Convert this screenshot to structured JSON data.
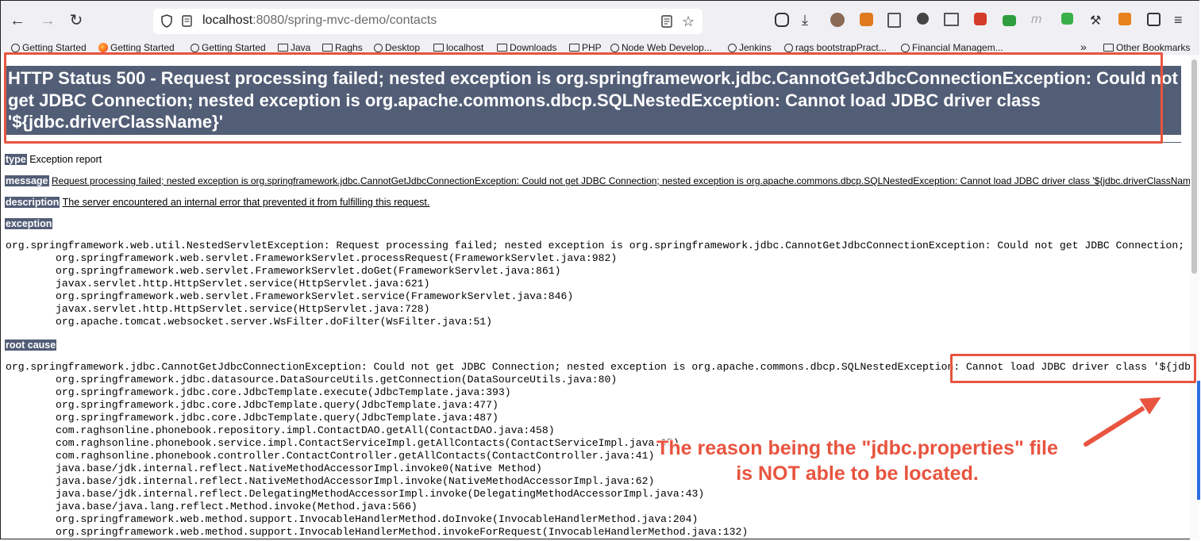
{
  "browser": {
    "url_host": "localhost",
    "url_rest": ":8080/spring-mvc-demo/contacts"
  },
  "bookmarks": [
    {
      "label": "Getting Started",
      "icon": "globe-icon"
    },
    {
      "label": "Getting Started",
      "icon": "firefox-icon"
    },
    {
      "label": "Getting Started",
      "icon": "globe-icon"
    },
    {
      "label": "Java",
      "icon": "folder-icon"
    },
    {
      "label": "Raghs",
      "icon": "folder-icon"
    },
    {
      "label": "Desktop",
      "icon": "globe-icon"
    },
    {
      "label": "localhost",
      "icon": "folder-icon"
    },
    {
      "label": "Downloads",
      "icon": "folder-icon"
    },
    {
      "label": "PHP",
      "icon": "folder-icon"
    },
    {
      "label": "Node Web Develop...",
      "icon": "globe-icon"
    },
    {
      "label": "Jenkins",
      "icon": "globe-icon"
    },
    {
      "label": "rags bootstrapPract...",
      "icon": "globe-icon"
    },
    {
      "label": "Financial Managem...",
      "icon": "globe-icon"
    }
  ],
  "other_bookmarks": "Other Bookmarks",
  "overflow_glyph": "»",
  "page": {
    "title": "HTTP Status 500 - Request processing failed; nested exception is org.springframework.jdbc.CannotGetJdbcConnectionException: Could not get JDBC Connection; nested exception is org.apache.commons.dbcp.SQLNestedException: Cannot load JDBC driver class '${jdbc.driverClassName}'",
    "type_label": "type",
    "type_value": "Exception report",
    "message_label": "message",
    "message_value": "Request processing failed; nested exception is org.springframework.jdbc.CannotGetJdbcConnectionException: Could not get JDBC Connection; nested exception is org.apache.commons.dbcp.SQLNestedException: Cannot load JDBC driver class '${jdbc.driverClassName}'",
    "description_label": "description",
    "description_value": "The server encountered an internal error that prevented it from fulfilling this request.",
    "exception_label": "exception",
    "exception_trace": [
      "org.springframework.web.util.NestedServletException: Request processing failed; nested exception is org.springframework.jdbc.CannotGetJdbcConnectionException: Could not get JDBC Connection; nested exception is org.apache.commons.dbcp.SQLNestedException: Cannot load JDBC driver class '${jdbc.driverClassName}'",
      "org.springframework.web.servlet.FrameworkServlet.processRequest(FrameworkServlet.java:982)",
      "org.springframework.web.servlet.FrameworkServlet.doGet(FrameworkServlet.java:861)",
      "javax.servlet.http.HttpServlet.service(HttpServlet.java:621)",
      "org.springframework.web.servlet.FrameworkServlet.service(FrameworkServlet.java:846)",
      "javax.servlet.http.HttpServlet.service(HttpServlet.java:728)",
      "org.apache.tomcat.websocket.server.WsFilter.doFilter(WsFilter.java:51)"
    ],
    "root_cause_label": "root cause",
    "root_cause_trace": [
      "org.springframework.jdbc.CannotGetJdbcConnectionException: Could not get JDBC Connection; nested exception is org.apache.commons.dbcp.SQLNestedException: Cannot load JDBC driver class '${jdbc.driverClassName}'",
      "org.springframework.jdbc.datasource.DataSourceUtils.getConnection(DataSourceUtils.java:80)",
      "org.springframework.jdbc.core.JdbcTemplate.execute(JdbcTemplate.java:393)",
      "org.springframework.jdbc.core.JdbcTemplate.query(JdbcTemplate.java:477)",
      "org.springframework.jdbc.core.JdbcTemplate.query(JdbcTemplate.java:487)",
      "com.raghsonline.phonebook.repository.impl.ContactDAO.getAll(ContactDAO.java:458)",
      "com.raghsonline.phonebook.service.impl.ContactServiceImpl.getAllContacts(ContactServiceImpl.java:97)",
      "com.raghsonline.phonebook.controller.ContactController.getAllContacts(ContactController.java:41)",
      "java.base/jdk.internal.reflect.NativeMethodAccessorImpl.invoke0(Native Method)",
      "java.base/jdk.internal.reflect.NativeMethodAccessorImpl.invoke(NativeMethodAccessorImpl.java:62)",
      "java.base/jdk.internal.reflect.DelegatingMethodAccessorImpl.invoke(DelegatingMethodAccessorImpl.java:43)",
      "java.base/java.lang.reflect.Method.invoke(Method.java:566)",
      "org.springframework.web.method.support.InvocableHandlerMethod.doInvoke(InvocableHandlerMethod.java:204)",
      "org.springframework.web.method.support.InvocableHandlerMethod.invokeForRequest(InvocableHandlerMethod.java:132)"
    ]
  },
  "annotation": {
    "line1": "The reason being the \"jdbc.properties\" file",
    "line2": "is NOT able to be located."
  },
  "colors": {
    "header_bg": "#525d76",
    "annotation": "#e8543f",
    "toolbar_bg": "#f0f0f4"
  }
}
